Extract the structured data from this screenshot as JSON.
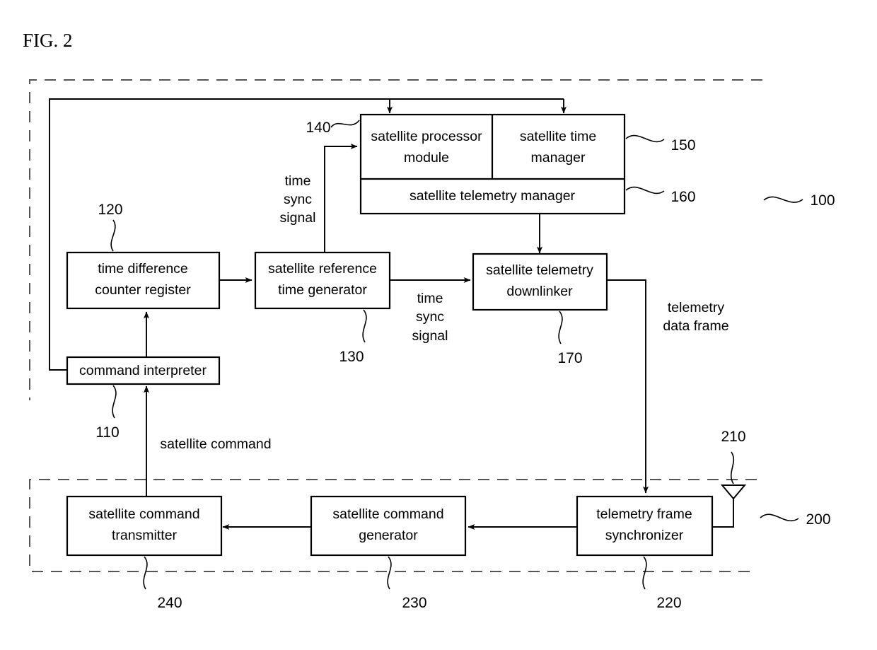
{
  "figure": {
    "title": "FIG. 2",
    "type": "patent-block-diagram"
  },
  "regions": [
    {
      "id": "satellite-region",
      "ref": "100"
    },
    {
      "id": "ground-region",
      "ref": "200"
    }
  ],
  "blocks": [
    {
      "id": "command-interpreter",
      "ref": "110",
      "line1": "command interpreter",
      "line2": ""
    },
    {
      "id": "time-difference-counter",
      "ref": "120",
      "line1": "time difference",
      "line2": "counter register"
    },
    {
      "id": "reference-time-generator",
      "ref": "130",
      "line1": "satellite reference",
      "line2": "time generator"
    },
    {
      "id": "processor-module",
      "ref": "140",
      "line1": "satellite processor",
      "line2": "module"
    },
    {
      "id": "time-manager",
      "ref": "150",
      "line1": "satellite time",
      "line2": "manager"
    },
    {
      "id": "telemetry-manager",
      "ref": "160",
      "line1": "satellite telemetry manager",
      "line2": ""
    },
    {
      "id": "telemetry-downlinker",
      "ref": "170",
      "line1": "satellite telemetry",
      "line2": "downlinker"
    },
    {
      "id": "antenna",
      "ref": "210",
      "line1": "",
      "line2": ""
    },
    {
      "id": "frame-synchronizer",
      "ref": "220",
      "line1": "telemetry frame",
      "line2": "synchronizer"
    },
    {
      "id": "command-generator",
      "ref": "230",
      "line1": "satellite command",
      "line2": "generator"
    },
    {
      "id": "command-transmitter",
      "ref": "240",
      "line1": "satellite command",
      "line2": "transmitter"
    }
  ],
  "signals": [
    {
      "id": "time-sync-signal-up",
      "l1": "time",
      "l2": "sync",
      "l3": "signal"
    },
    {
      "id": "time-sync-signal-right",
      "l1": "time",
      "l2": "sync",
      "l3": "signal"
    },
    {
      "id": "telemetry-data-frame",
      "l1": "telemetry",
      "l2": "data frame",
      "l3": ""
    },
    {
      "id": "satellite-command",
      "l1": "satellite command",
      "l2": "",
      "l3": ""
    }
  ],
  "colors": {
    "ink": "#000000",
    "paper": "#ffffff",
    "dashed": "#555555"
  }
}
